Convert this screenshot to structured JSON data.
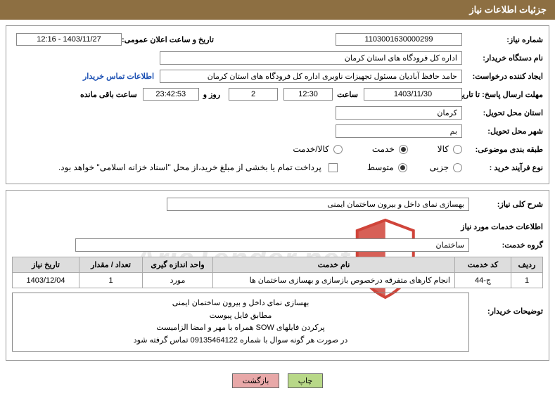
{
  "header": {
    "title": "جزئیات اطلاعات نیاز"
  },
  "general": {
    "lbl_need_no": "شماره نیاز:",
    "need_no": "1103001630000299",
    "lbl_announce": "تاریخ و ساعت اعلان عمومی:",
    "announce": "1403/11/27 - 12:16",
    "lbl_buyer_org": "نام دستگاه خریدار:",
    "buyer_org": "اداره کل فرودگاه های استان کرمان",
    "lbl_requester": "ایجاد کننده درخواست:",
    "requester": "حامد حافظ آبادیان مسئول تجهیزات ناوبری اداره کل فرودگاه های استان کرمان",
    "contact_link": "اطلاعات تماس خریدار",
    "lbl_deadline": "مهلت ارسال پاسخ: تا تاریخ:",
    "deadline_date": "1403/11/30",
    "lbl_time": "ساعت",
    "deadline_time": "12:30",
    "days_remain": "2",
    "lbl_days_and": "روز و",
    "time_remain": "23:42:53",
    "lbl_time_remain": "ساعت باقی مانده",
    "lbl_province": "استان محل تحویل:",
    "province": "کرمان",
    "lbl_city": "شهر محل تحویل:",
    "city": "بم",
    "lbl_category": "طبقه بندی موضوعی:",
    "cat_goods": "کالا",
    "cat_service": "خدمت",
    "cat_both": "کالا/خدمت",
    "lbl_proc_type": "نوع فرآیند خرید :",
    "proc_minor": "جزیی",
    "proc_medium": "متوسط",
    "payment_note": "پرداخت تمام یا بخشی از مبلغ خرید،از محل \"اسناد خزانه اسلامی\" خواهد بود."
  },
  "desc": {
    "lbl_overall": "شرح کلی نیاز:",
    "overall": "بهسازی نمای داخل و بیرون ساختمان ایمنی",
    "lbl_info": "اطلاعات خدمات مورد نیاز",
    "lbl_group": "گروه خدمت:",
    "group": "ساختمان"
  },
  "table": {
    "h_row": "ردیف",
    "h_code": "کد خدمت",
    "h_name": "نام خدمت",
    "h_unit": "واحد اندازه گیری",
    "h_qty": "تعداد / مقدار",
    "h_date": "تاریخ نیاز",
    "rows": [
      {
        "no": "1",
        "code": "ج-44",
        "name": "انجام کارهای متفرقه درخصوص بازسازی و بهسازی ساختمان ها",
        "unit": "مورد",
        "qty": "1",
        "date": "1403/12/04"
      }
    ]
  },
  "notes": {
    "lbl": "توضیحات خریدار:",
    "l1": "بهسازی نمای داخل و بیرون ساختمان ایمنی",
    "l2": "مطابق فایل پیوست",
    "l3": "پرکردن فایلهای SOW همراه با مهر و امضا الزامیست",
    "l4": "در صورت هر گونه سوال با شماره 09135464122 تماس گرفته شود"
  },
  "buttons": {
    "print": "چاپ",
    "back": "بازگشت"
  },
  "watermark": "AriaTender.net"
}
